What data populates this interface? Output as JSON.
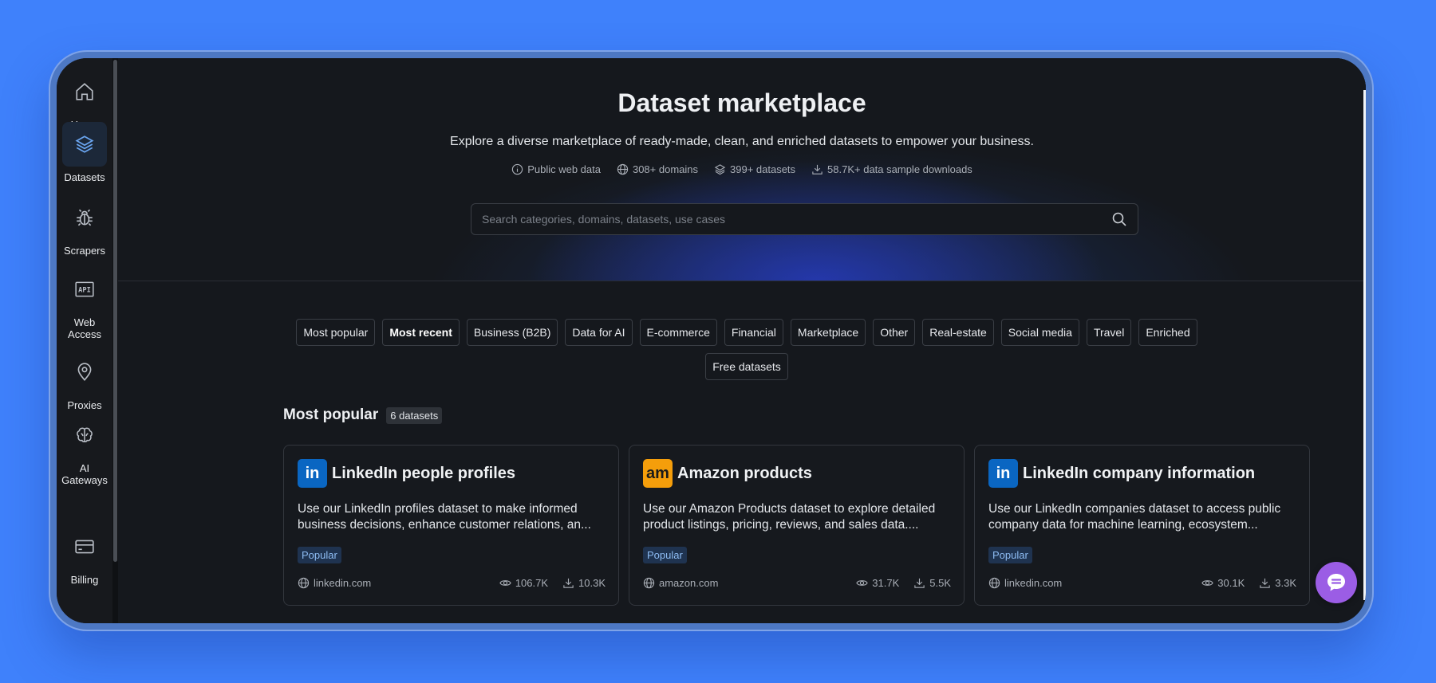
{
  "colors": {
    "background": "#3f81fb",
    "panel": "#15181d",
    "accent_active": "#1c2839",
    "popular_tag": "#8ebcf3",
    "linkedin": "#0a66c2",
    "amazon": "#f59e0b",
    "chat": "#9b5de5"
  },
  "sidebar": {
    "items": [
      {
        "label": "Home",
        "icon": "home-icon"
      },
      {
        "label": "Datasets",
        "icon": "layers-icon",
        "active": true
      },
      {
        "label": "Scrapers",
        "icon": "bug-icon"
      },
      {
        "label": "Web Access",
        "icon": "api-icon"
      },
      {
        "label": "Proxies",
        "icon": "location-pin-icon"
      },
      {
        "label": "AI Gateways",
        "icon": "brain-icon"
      },
      {
        "label": "Billing",
        "icon": "card-icon"
      }
    ]
  },
  "hero": {
    "title": "Dataset marketplace",
    "subtitle": "Explore a diverse marketplace of ready-made, clean, and enriched datasets to empower your business.",
    "stats": [
      {
        "icon": "info-icon",
        "text": "Public web data"
      },
      {
        "icon": "globe-icon",
        "text": "308+ domains"
      },
      {
        "icon": "layers-icon",
        "text": "399+ datasets"
      },
      {
        "icon": "download-icon",
        "text": "58.7K+ data sample downloads"
      }
    ],
    "search_placeholder": "Search categories, domains, datasets, use cases"
  },
  "filters": {
    "chips": [
      "Most popular",
      "Most recent",
      "Business (B2B)",
      "Data for AI",
      "E-commerce",
      "Financial",
      "Marketplace",
      "Other",
      "Real-estate",
      "Social media",
      "Travel",
      "Enriched",
      "Free datasets"
    ],
    "active": "Most recent"
  },
  "section": {
    "title": "Most popular",
    "count": "6 datasets"
  },
  "cards": [
    {
      "logo": "in",
      "logo_color": "#0a66c2",
      "title": "LinkedIn people profiles",
      "description": "Use our LinkedIn profiles dataset to make informed business decisions, enhance customer relations, an...",
      "tag": "Popular",
      "domain": "linkedin.com",
      "views": "106.7K",
      "downloads": "10.3K"
    },
    {
      "logo": "am",
      "logo_color": "#f59e0b",
      "title": "Amazon products",
      "description": "Use our Amazon Products dataset to explore detailed product listings, pricing, reviews, and sales data....",
      "tag": "Popular",
      "domain": "amazon.com",
      "views": "31.7K",
      "downloads": "5.5K"
    },
    {
      "logo": "in",
      "logo_color": "#0a66c2",
      "title": "LinkedIn company information",
      "description": "Use our LinkedIn companies dataset to access public company data for machine learning, ecosystem...",
      "tag": "Popular",
      "domain": "linkedin.com",
      "views": "30.1K",
      "downloads": "3.3K"
    }
  ]
}
